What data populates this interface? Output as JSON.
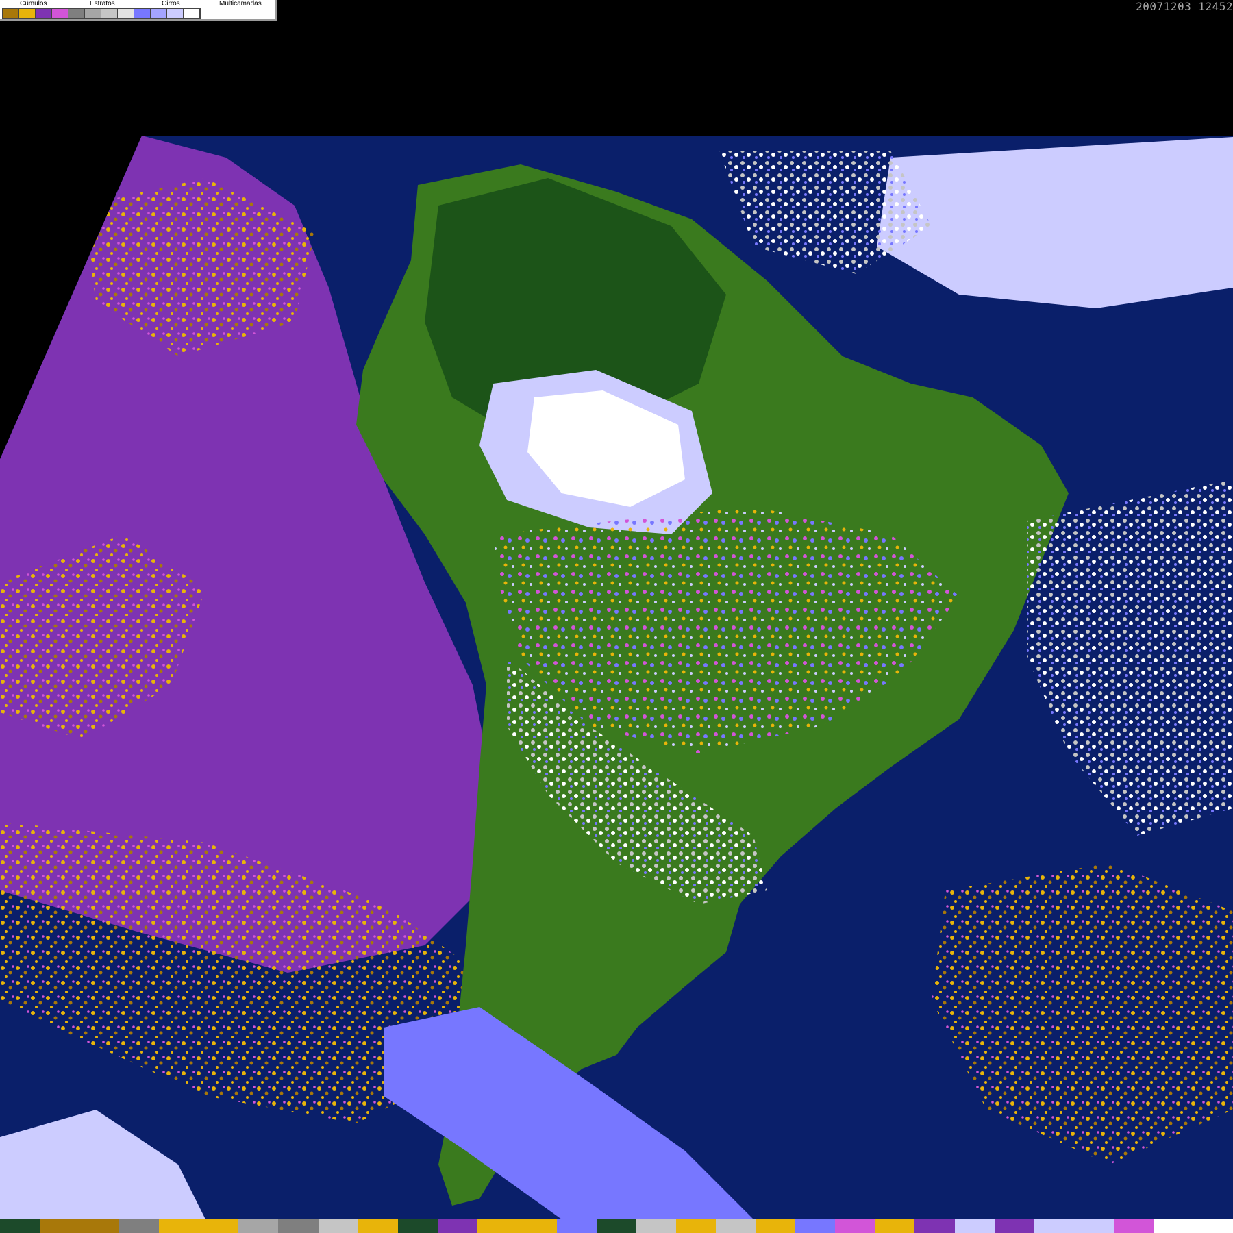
{
  "timestamp": "20071203 12452",
  "legend": {
    "groups": [
      {
        "label": "Cúmulos"
      },
      {
        "label": "Estratos"
      },
      {
        "label": "Cirros"
      },
      {
        "label": "Multicamadas"
      }
    ],
    "swatches": [
      "#a8780a",
      "#e8b40a",
      "#7e33b2",
      "#d255d8",
      "#7f7f7f",
      "#a6a6a6",
      "#c5c5c5",
      "#e2e2e2",
      "#7777ff",
      "#a4a4ff",
      "#ccccff",
      "#ffffff"
    ]
  },
  "colors": {
    "background": "#000000",
    "ocean": "#0a1f6a",
    "land": "#3a7a1e",
    "land_dark": "#1c5418",
    "stratus": "#7e33b2",
    "stratus_light": "#d255d8",
    "cumulus": "#e8b40a",
    "cumulus_dark": "#a8780a",
    "cirrus": "#c5c5c5",
    "multilayer": "#7777ff",
    "multilayer_light": "#ccccff"
  },
  "bottom_strip": [
    "#1c4a2a",
    "#a8780a",
    "#a8780a",
    "#7f7f7f",
    "#e8b40a",
    "#e8b40a",
    "#a6a6a6",
    "#7f7f7f",
    "#c5c5c5",
    "#e8b40a",
    "#1c4a2a",
    "#7e33b2",
    "#e8b40a",
    "#e8b40a",
    "#7777ff",
    "#1c4a2a",
    "#c5c5c5",
    "#e8b40a",
    "#c5c5c5",
    "#e8b40a",
    "#7777ff",
    "#d255d8",
    "#e8b40a",
    "#7e33b2",
    "#ccccff",
    "#7e33b2",
    "#ccccff",
    "#ccccff",
    "#d255d8",
    "#ffffff",
    "#ffffff"
  ]
}
